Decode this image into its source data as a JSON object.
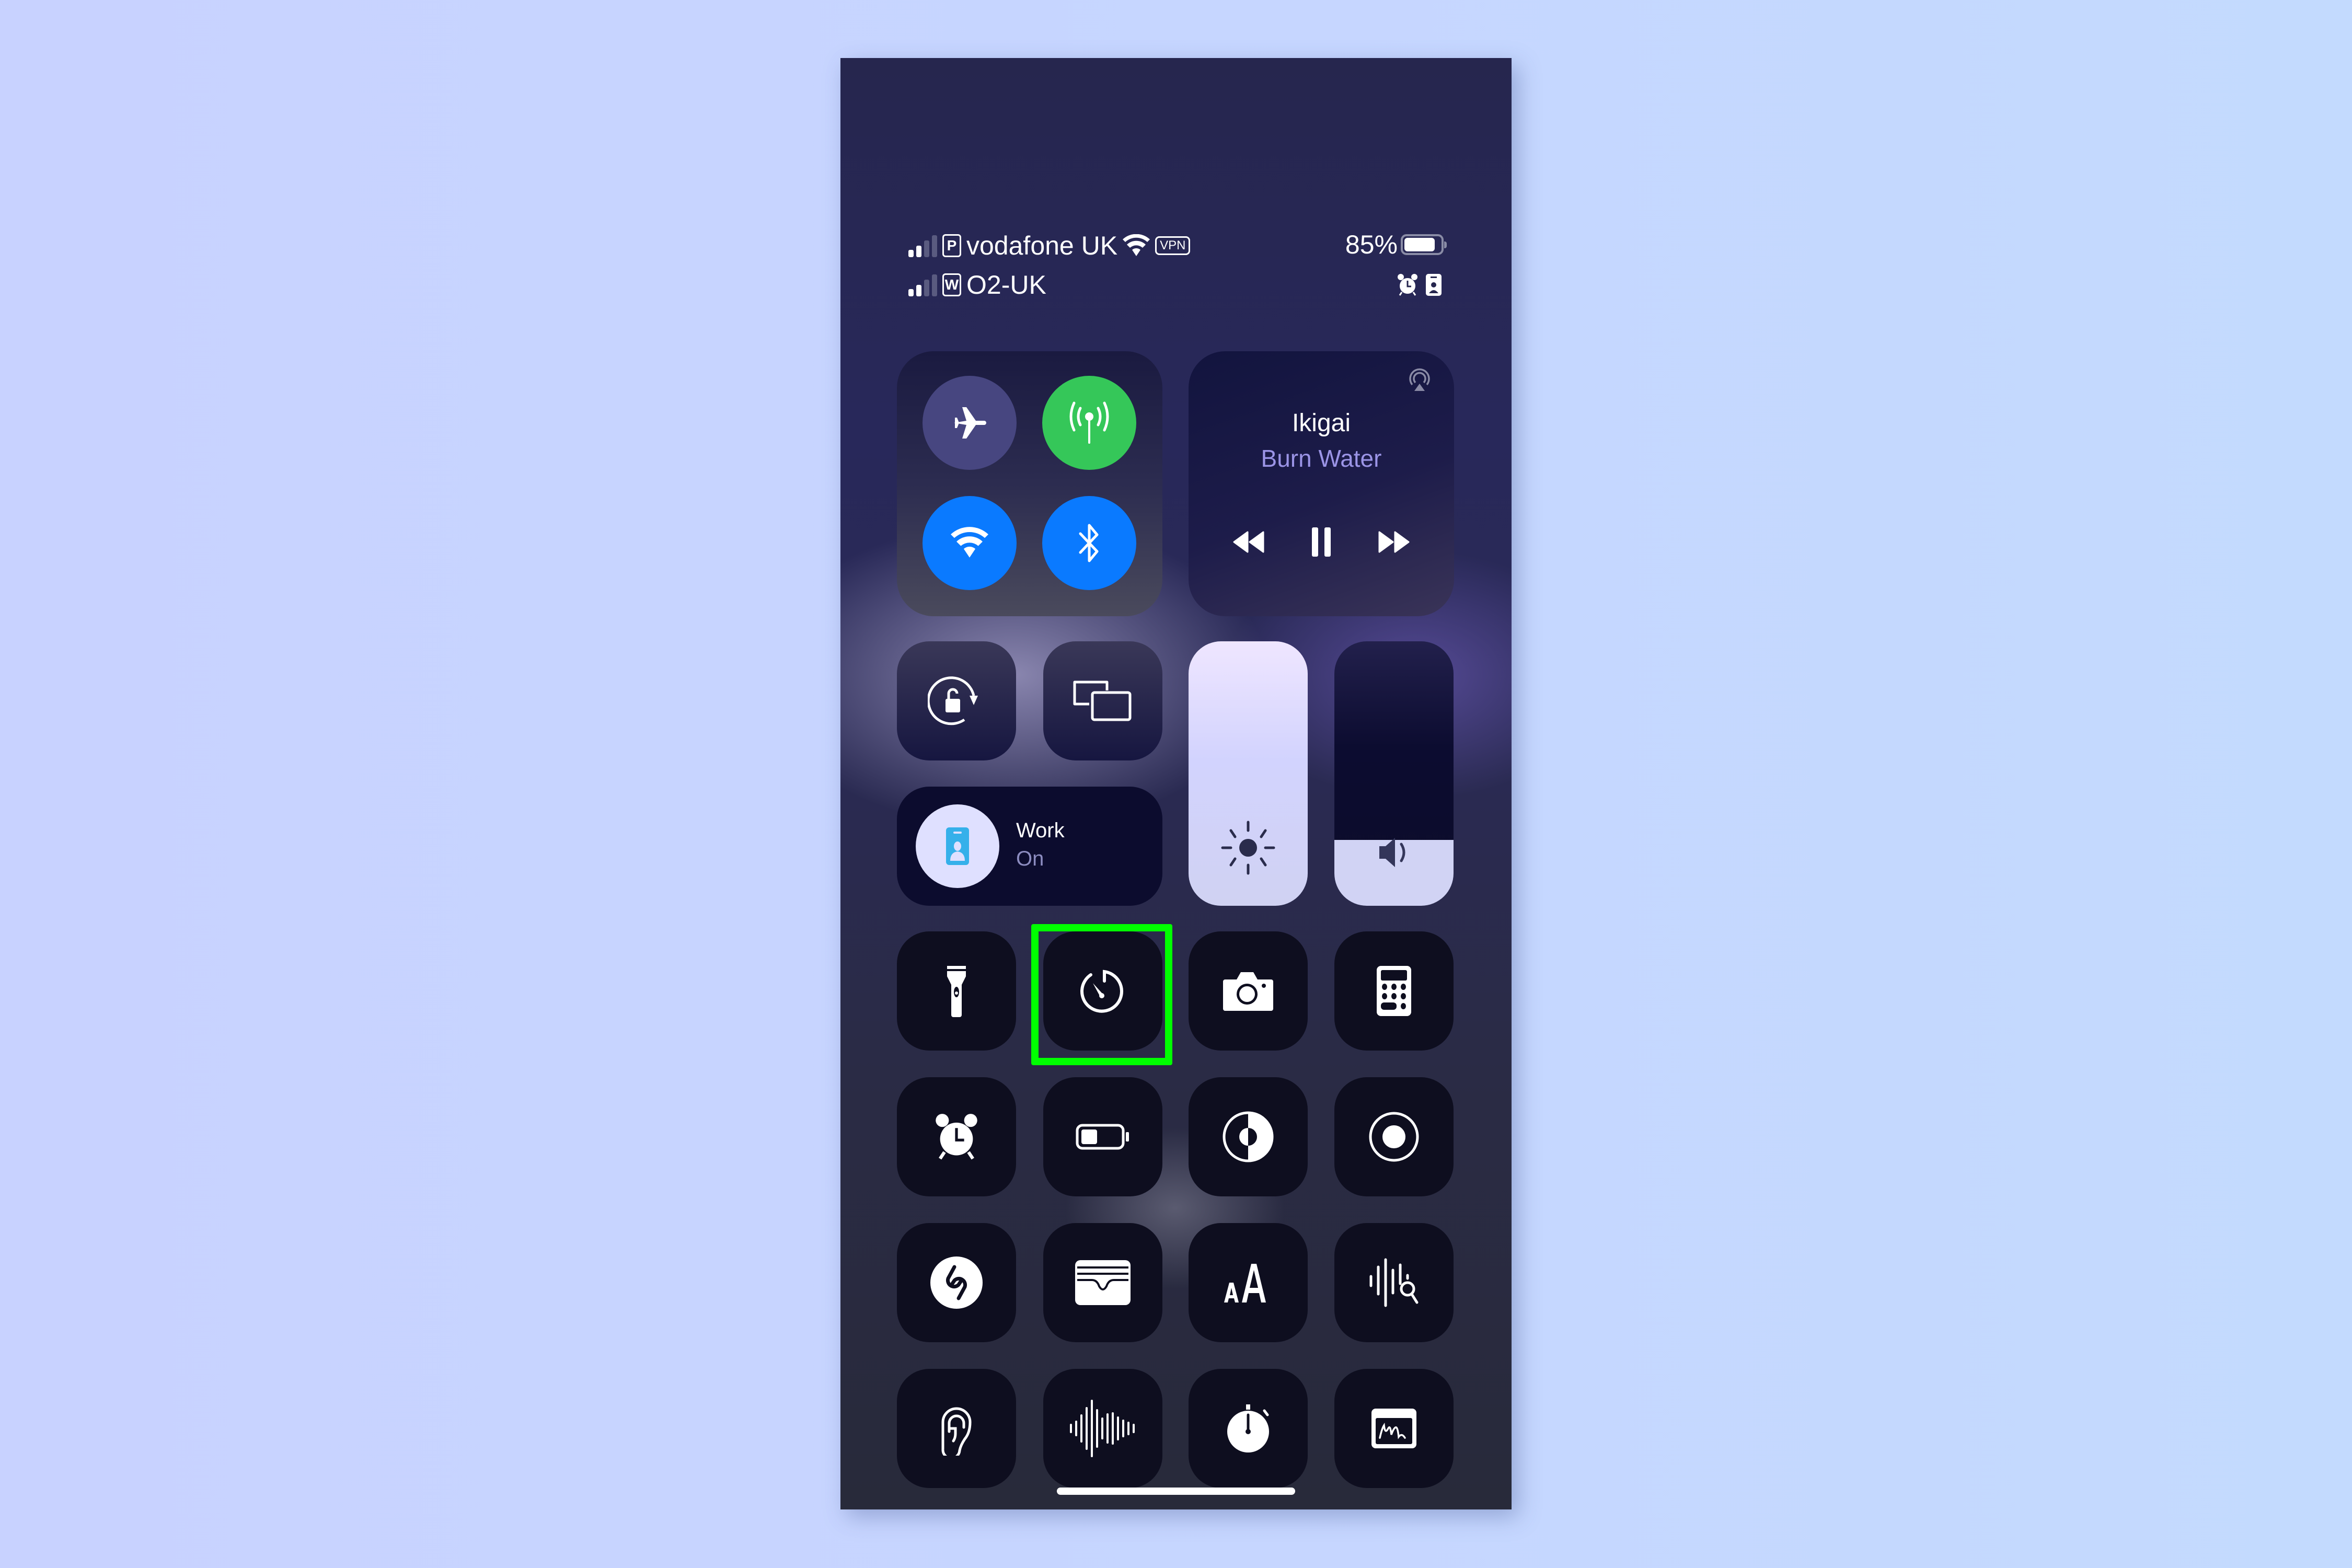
{
  "status_bar": {
    "carrier1": {
      "sim_label": "P",
      "name": "vodafone UK",
      "vpn_label": "VPN",
      "signal_bars": 2,
      "signal_max": 4
    },
    "carrier2": {
      "sim_label": "W",
      "name": "O2-UK",
      "signal_bars": 2,
      "signal_max": 4
    },
    "battery_text": "85%",
    "battery_level": 0.85,
    "icons": [
      "wifi-icon",
      "alarm-icon",
      "focus-work-icon"
    ]
  },
  "connectivity": {
    "airplane": {
      "label": "Airplane Mode",
      "on": false
    },
    "cellular": {
      "label": "Cellular Data",
      "on": true,
      "color": "#34c759"
    },
    "wifi": {
      "label": "Wi-Fi",
      "on": true,
      "color": "#0a7aff"
    },
    "bluetooth": {
      "label": "Bluetooth",
      "on": true,
      "color": "#0a7aff"
    }
  },
  "media": {
    "title": "Ikigai",
    "artist": "Burn Water",
    "state": "playing"
  },
  "focus": {
    "name": "Work",
    "state": "On",
    "icon_color": "#35b0ea"
  },
  "sliders": {
    "brightness": {
      "label": "Brightness",
      "level": 1.0
    },
    "volume": {
      "label": "Volume",
      "level": 0.25
    }
  },
  "controls": [
    {
      "id": "orientation-lock",
      "label": "Orientation Lock"
    },
    {
      "id": "screen-mirroring",
      "label": "Screen Mirroring"
    },
    {
      "id": "flashlight",
      "label": "Flashlight"
    },
    {
      "id": "timer",
      "label": "Timer",
      "highlighted": true
    },
    {
      "id": "camera",
      "label": "Camera"
    },
    {
      "id": "calculator",
      "label": "Calculator"
    },
    {
      "id": "alarm",
      "label": "Alarm"
    },
    {
      "id": "low-power",
      "label": "Low Power Mode"
    },
    {
      "id": "dark-mode",
      "label": "Dark Mode"
    },
    {
      "id": "screen-recording",
      "label": "Screen Recording"
    },
    {
      "id": "shazam",
      "label": "Music Recognition"
    },
    {
      "id": "wallet",
      "label": "Wallet"
    },
    {
      "id": "text-size",
      "label": "Text Size"
    },
    {
      "id": "sound-recognition",
      "label": "Sound Recognition"
    },
    {
      "id": "hearing",
      "label": "Hearing"
    },
    {
      "id": "voice-memos",
      "label": "Voice Memos"
    },
    {
      "id": "stopwatch",
      "label": "Stopwatch"
    },
    {
      "id": "quick-note",
      "label": "Quick Note"
    }
  ],
  "annotation": {
    "highlight_color": "#00ff00",
    "target": "timer"
  }
}
